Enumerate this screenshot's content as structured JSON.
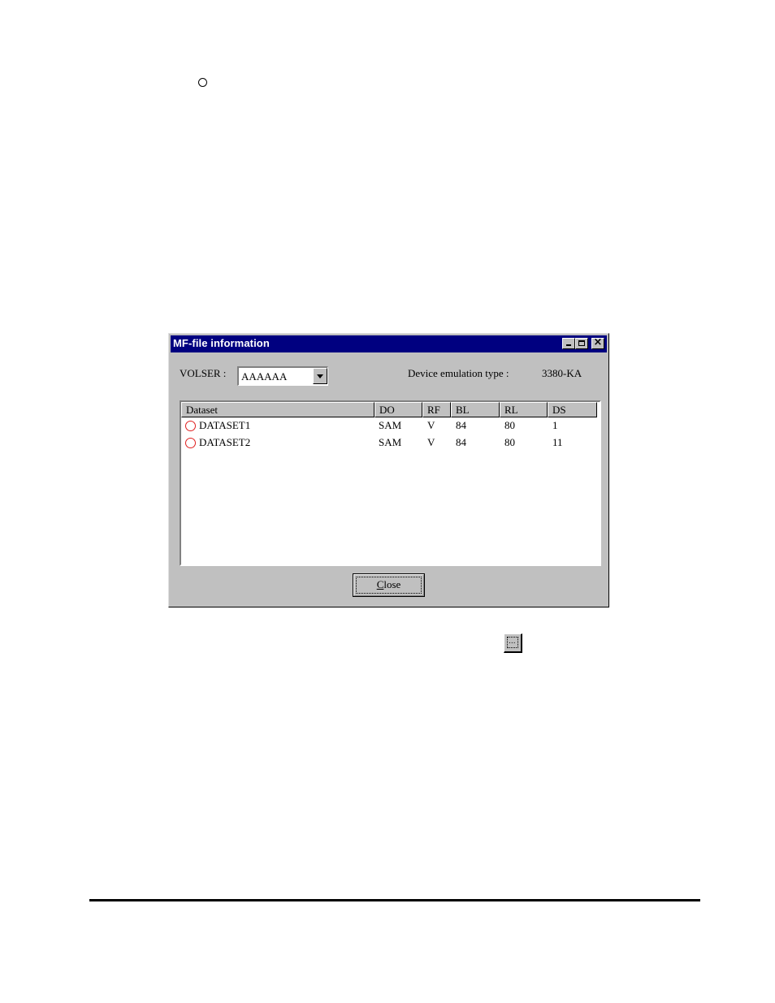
{
  "window": {
    "title": "MF-file information"
  },
  "volser": {
    "label": "VOLSER :",
    "value": "AAAAAA"
  },
  "device": {
    "label": "Device emulation type :",
    "value": "3380-KA"
  },
  "list": {
    "columns": [
      "Dataset",
      "DO",
      "RF",
      "BL",
      "RL",
      "DS"
    ],
    "rows": [
      {
        "dataset": "DATASET1",
        "do": "SAM",
        "rf": "V",
        "bl": "84",
        "rl": "80",
        "ds": "1"
      },
      {
        "dataset": "DATASET2",
        "do": "SAM",
        "rf": "V",
        "bl": "84",
        "rl": "80",
        "ds": "11"
      }
    ]
  },
  "buttons": {
    "close_mnemonic": "C",
    "close_rest": "lose",
    "small_button_glyph": "..."
  },
  "colors": {
    "titlebar": "#000080",
    "dialog_face": "#c0c0c0",
    "dataset_icon": "#e02020"
  },
  "icons": {
    "page_bullet": "hollow-circle",
    "dataset_status": "red-circle-icon"
  }
}
